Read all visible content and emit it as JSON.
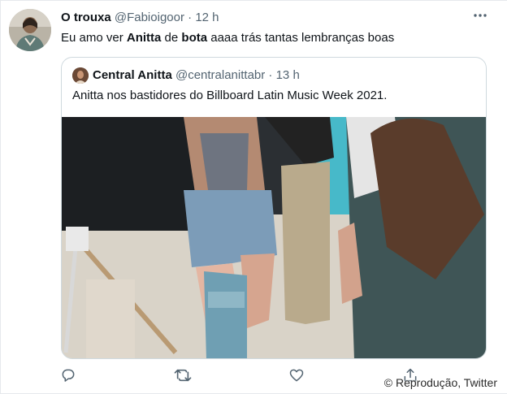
{
  "tweet": {
    "display_name": "O trouxa",
    "handle": "@Fabioigoor",
    "separator": "·",
    "time": "12 h",
    "text_parts": [
      "Eu amo ver ",
      "Anitta",
      " de ",
      "bota",
      " aaaa trás tantas lembranças boas"
    ]
  },
  "quoted": {
    "display_name": "Central Anitta",
    "handle": "@centralanittabr",
    "separator": "·",
    "time": "13 h",
    "text": "Anitta nos bastidores do Billboard Latin Music Week 2021."
  },
  "icons": {
    "more": "more-horizontal-icon",
    "reply": "reply-icon",
    "retweet": "retweet-icon",
    "like": "like-icon",
    "share": "share-icon"
  },
  "credit": "© Reprodução, Twitter",
  "colors": {
    "text": "#0f1419",
    "secondary": "#536471",
    "border": "#cfd9de"
  }
}
